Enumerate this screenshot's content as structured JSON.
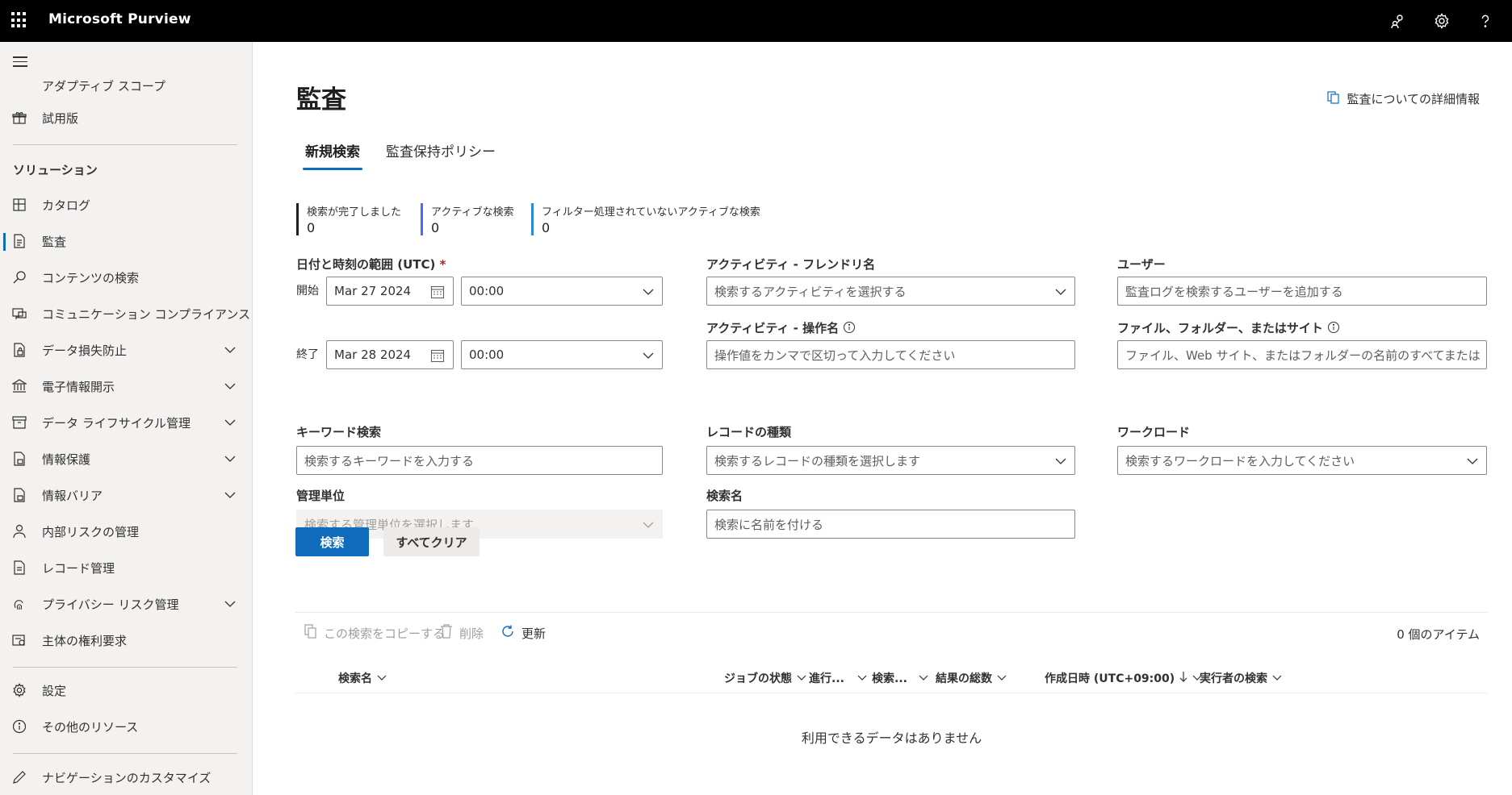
{
  "app": {
    "title": "Microsoft Purview"
  },
  "sidebar": {
    "items_top": [
      {
        "label": "アダプティブ スコープ"
      },
      {
        "label": "試用版",
        "icon": "gift-icon"
      }
    ],
    "section_title": "ソリューション",
    "items": [
      {
        "label": "カタログ",
        "icon": "catalog-icon",
        "expandable": false
      },
      {
        "label": "監査",
        "icon": "audit-icon",
        "expandable": false,
        "active": true
      },
      {
        "label": "コンテンツの検索",
        "icon": "search-icon",
        "expandable": false
      },
      {
        "label": "コミュニケーション コンプライアンス",
        "icon": "chat-icon",
        "expandable": false
      },
      {
        "label": "データ損失防止",
        "icon": "dlp-icon",
        "expandable": true
      },
      {
        "label": "電子情報開示",
        "icon": "bank-icon",
        "expandable": true
      },
      {
        "label": "データ ライフサイクル管理",
        "icon": "archive-icon",
        "expandable": true
      },
      {
        "label": "情報保護",
        "icon": "lock-doc-icon",
        "expandable": true
      },
      {
        "label": "情報バリア",
        "icon": "barrier-icon",
        "expandable": true
      },
      {
        "label": "内部リスクの管理",
        "icon": "person-icon",
        "expandable": false
      },
      {
        "label": "レコード管理",
        "icon": "records-icon",
        "expandable": false
      },
      {
        "label": "プライバシー リスク管理",
        "icon": "fingerprint-icon",
        "expandable": true
      },
      {
        "label": "主体の権利要求",
        "icon": "request-icon",
        "expandable": false
      }
    ],
    "bottom_items": [
      {
        "label": "設定",
        "icon": "gear-icon"
      },
      {
        "label": "その他のリソース",
        "icon": "info-icon"
      }
    ],
    "customize": {
      "label": "ナビゲーションのカスタマイズ",
      "icon": "pencil-icon"
    }
  },
  "page": {
    "title": "監査",
    "learn_more": "監査についての詳細情報",
    "tabs": [
      {
        "label": "新規検索",
        "active": true
      },
      {
        "label": "監査保持ポリシー",
        "active": false
      }
    ],
    "stats": [
      {
        "label": "検索が完了しました",
        "value": "0"
      },
      {
        "label": "アクティブな検索",
        "value": "0"
      },
      {
        "label": "フィルター処理されていないアクティブな検索",
        "value": "0"
      }
    ]
  },
  "form": {
    "date_range": {
      "label": "日付と時刻の範囲 (UTC)",
      "required_mark": "*",
      "start_label": "開始",
      "start_date": "Mar 27 2024",
      "start_time": "00:00",
      "end_label": "終了",
      "end_date": "Mar 28 2024",
      "end_time": "00:00"
    },
    "keyword": {
      "label": "キーワード検索",
      "placeholder": "検索するキーワードを入力する"
    },
    "admin_unit": {
      "label": "管理単位",
      "placeholder": "検索する管理単位を選択します"
    },
    "activity_friendly": {
      "label": "アクティビティ - フレンドリ名",
      "placeholder": "検索するアクティビティを選択する"
    },
    "activity_op": {
      "label": "アクティビティ - 操作名",
      "placeholder": "操作値をカンマで区切って入力してください"
    },
    "record_type": {
      "label": "レコードの種類",
      "placeholder": "検索するレコードの種類を選択します"
    },
    "search_name": {
      "label": "検索名",
      "placeholder": "検索に名前を付ける"
    },
    "users": {
      "label": "ユーザー",
      "placeholder": "監査ログを検索するユーザーを追加する"
    },
    "files": {
      "label": "ファイル、フォルダー、またはサイト",
      "placeholder": "ファイル、Web サイト、またはフォルダーの名前のすべてまたは一部を入..."
    },
    "workload": {
      "label": "ワークロード",
      "placeholder": "検索するワークロードを入力してください"
    },
    "search_button": "検索",
    "clear_button": "すべてクリア"
  },
  "results": {
    "copy_label": "この検索をコピーする",
    "delete_label": "削除",
    "refresh_label": "更新",
    "item_count": "0 個のアイテム",
    "columns": [
      "検索名",
      "ジョブの状態",
      "進行...",
      "検索...",
      "結果の総数",
      "作成日時 (UTC+09:00)",
      "実行者の検索"
    ],
    "empty_message": "利用できるデータはありません"
  },
  "colors": {
    "accent": "#0f6cbd",
    "topbar": "#000000",
    "sidebar": "#f3f2f1"
  }
}
